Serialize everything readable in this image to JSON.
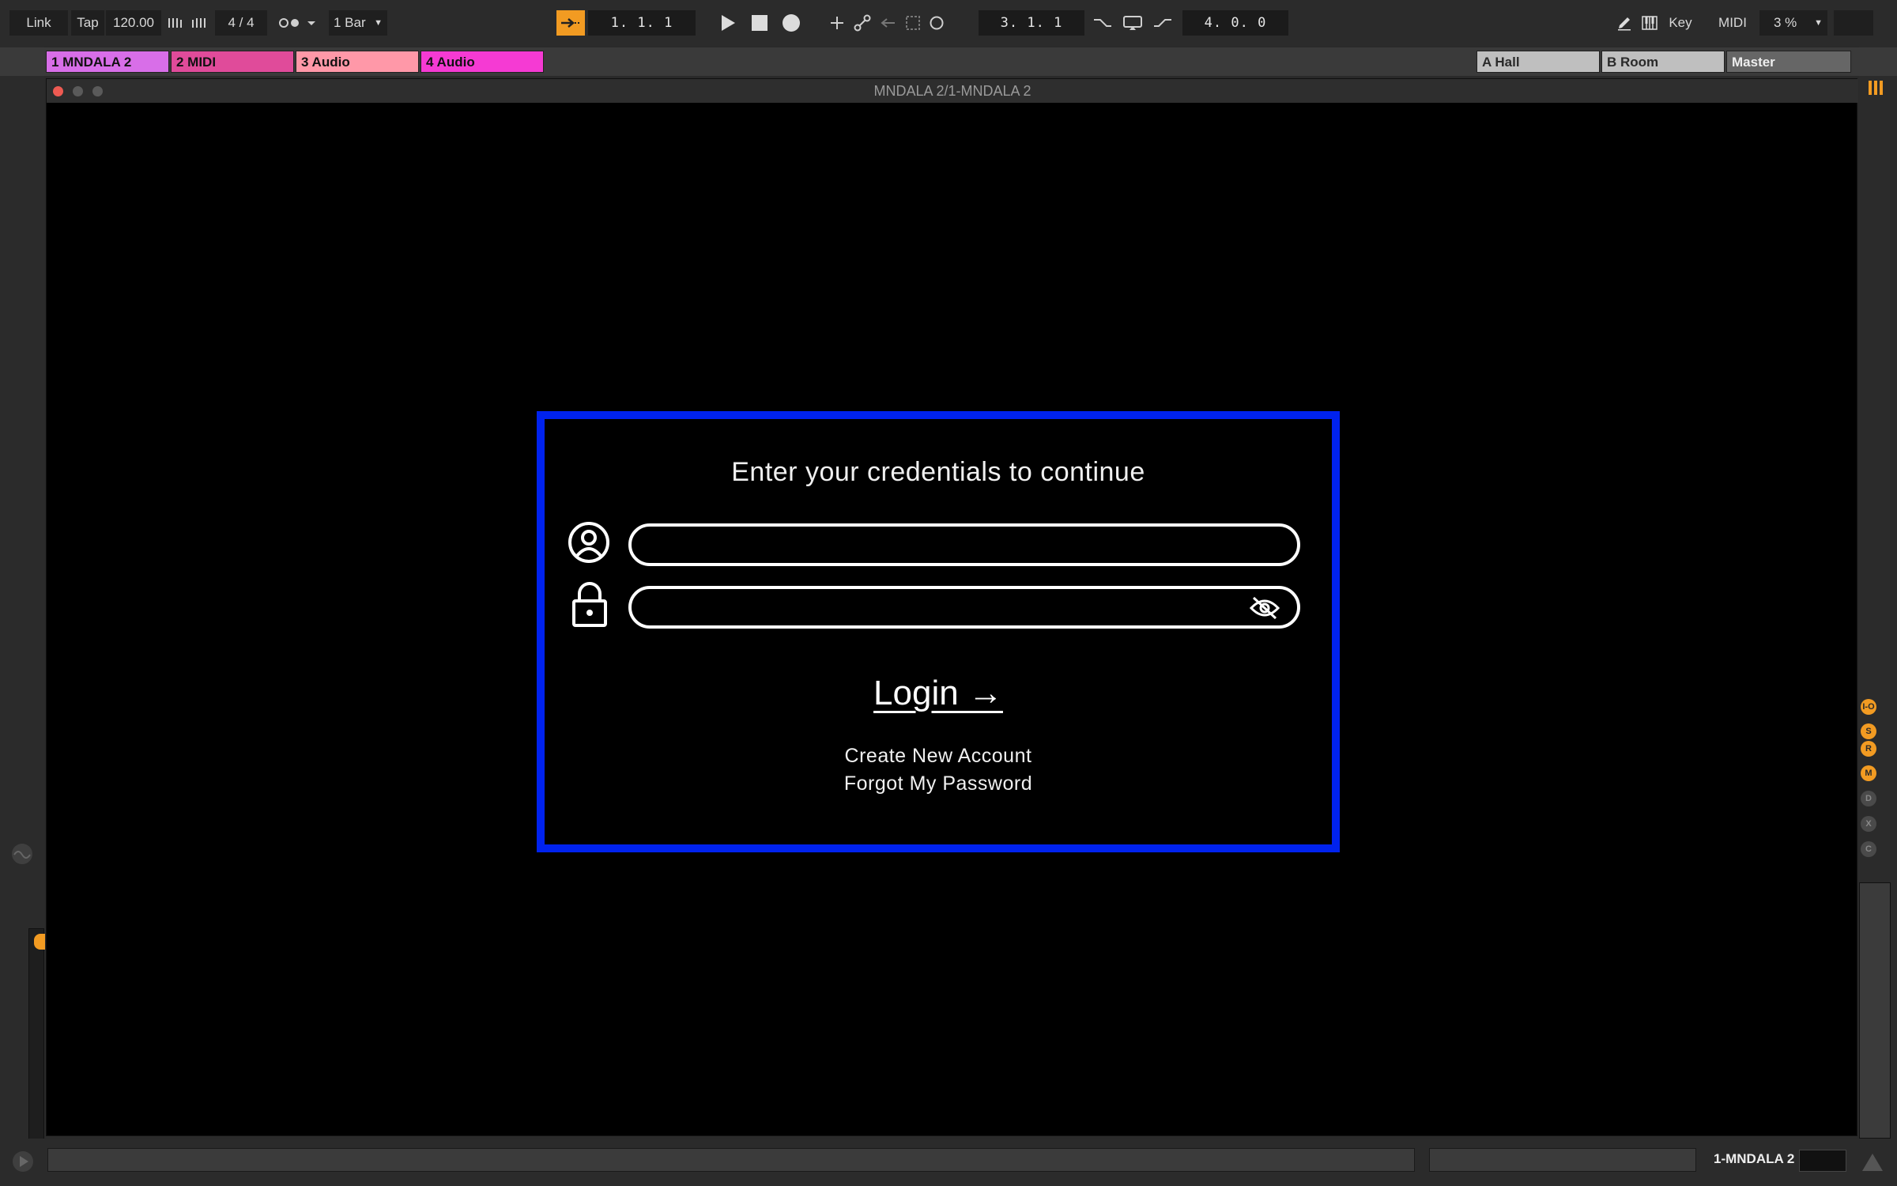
{
  "transport": {
    "link_label": "Link",
    "tap_label": "Tap",
    "tempo": "120.00",
    "time_signature": "4 / 4",
    "quantize": "1 Bar",
    "arrangement_position": "1.  1.  1",
    "loop_start": "3.  1.  1",
    "loop_length": "4.  0.  0",
    "key_label": "Key",
    "midi_label": "MIDI",
    "cpu_load": "3 %"
  },
  "tracks": [
    {
      "label": "1 MNDALA 2",
      "color": "#d86ee8"
    },
    {
      "label": "2 MIDI",
      "color": "#e04b9a"
    },
    {
      "label": "3 Audio",
      "color": "#ff98a8"
    },
    {
      "label": "4 Audio",
      "color": "#f53ad3"
    }
  ],
  "returns": [
    {
      "label": "A Hall"
    },
    {
      "label": "B Room"
    }
  ],
  "master_label": "Master",
  "window": {
    "title": "MNDALA 2/1-MNDALA 2"
  },
  "login": {
    "heading": "Enter your credentials to continue",
    "username_value": "",
    "password_value": "",
    "login_label": "Login →",
    "create_account_label": "Create New Account",
    "forgot_password_label": "Forgot My Password",
    "accent_color": "#0022ee"
  },
  "status": {
    "selected_track": "1-MNDALA 2"
  },
  "side_badges": [
    "I-O",
    "S",
    "R",
    "M",
    "D",
    "X",
    "C"
  ]
}
